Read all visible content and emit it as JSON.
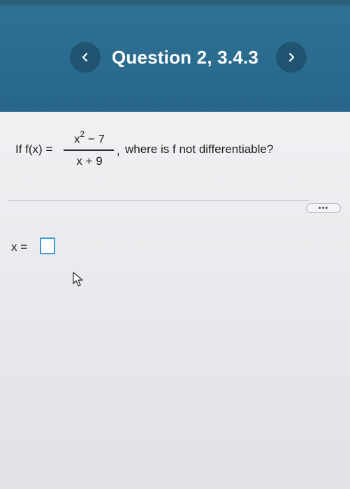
{
  "header": {
    "title": "Question 2, 3.4.3",
    "prev_icon": "chevron-left-icon",
    "next_icon": "chevron-right-icon"
  },
  "question": {
    "lhs": "If f(x) =",
    "numerator_base": "x",
    "numerator_exponent": "2",
    "numerator_rest": " − 7",
    "denominator": "x + 9",
    "comma": ",",
    "text": "where is f not differentiable?"
  },
  "more_button": {
    "label": "•••"
  },
  "answer": {
    "label": "x =",
    "value": ""
  },
  "colors": {
    "header_bg": "#2a6b8e",
    "content_bg": "#ecebee",
    "answer_box_border": "#3a9ad6"
  }
}
